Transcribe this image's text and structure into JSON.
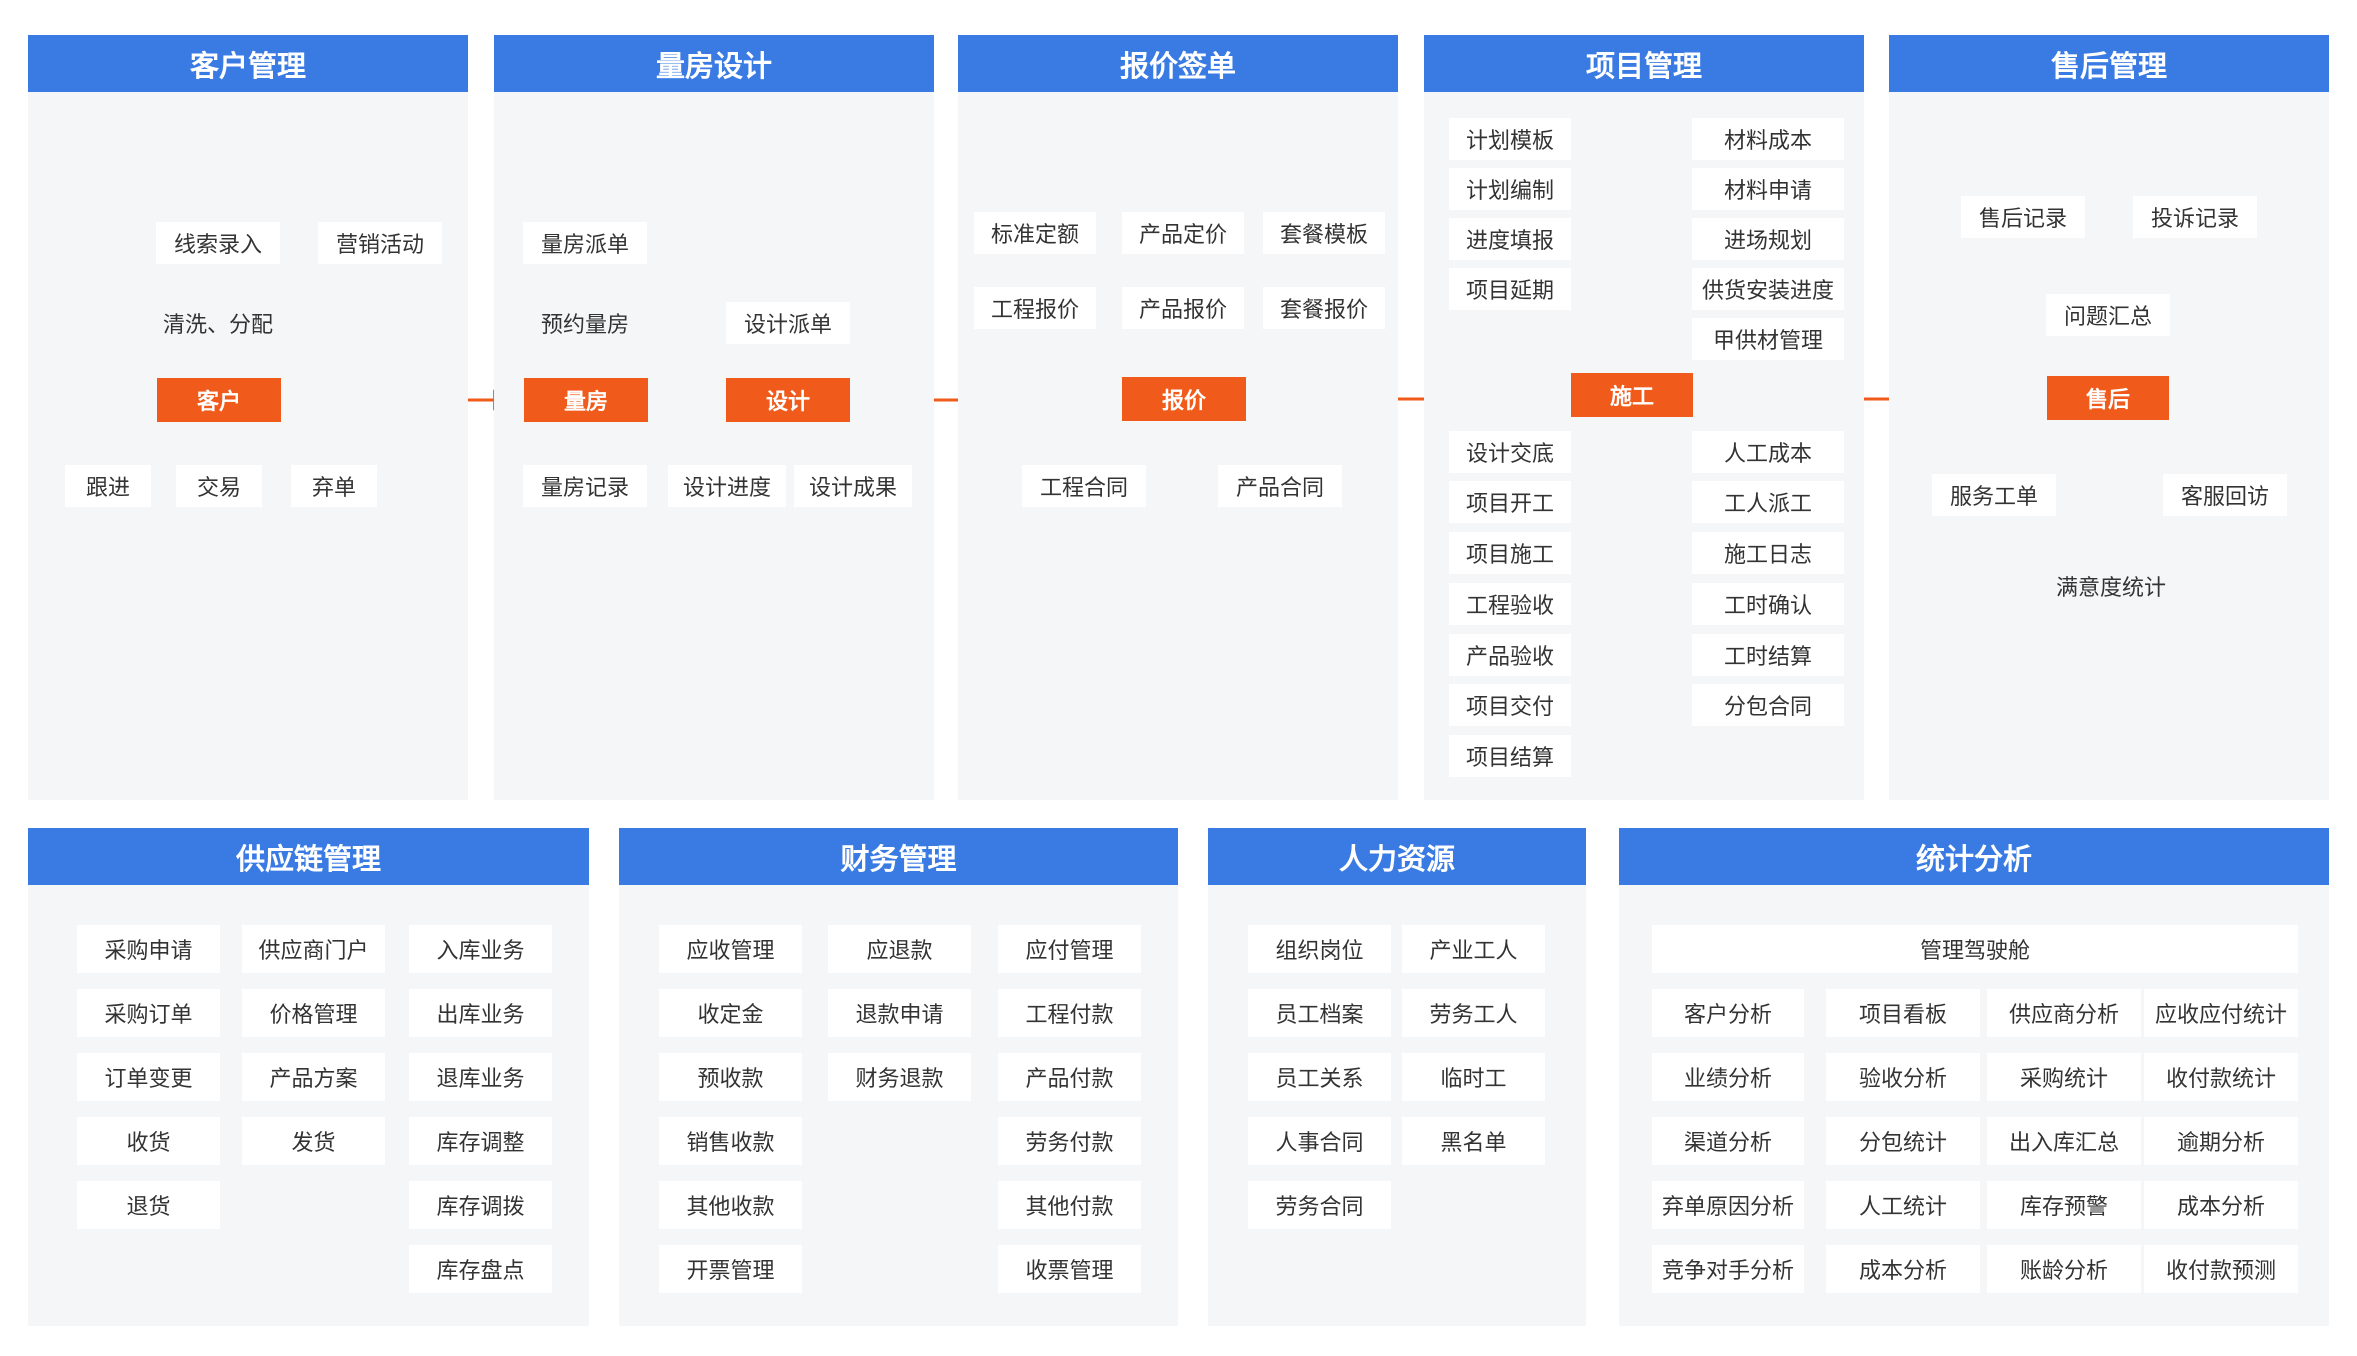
{
  "panels": {
    "customer": "客户管理",
    "measure": "量房设计",
    "quote": "报价签单",
    "project": "项目管理",
    "aftersale": "售后管理",
    "supply": "供应链管理",
    "finance": "财务管理",
    "hr": "人力资源",
    "stats": "统计分析"
  },
  "flow": {
    "customer": "客户",
    "measure": "量房",
    "design": "设计",
    "quote": "报价",
    "construct": "施工",
    "aftersale": "售后"
  },
  "customer": {
    "lead_entry": "线索录入",
    "marketing": "营销活动",
    "clean_assign": "清洗、分配",
    "follow": "跟进",
    "deal": "交易",
    "abandon": "弃单"
  },
  "measure": {
    "dispatch": "量房派单",
    "appointment": "预约量房",
    "record": "量房记录",
    "design_dispatch": "设计派单",
    "design_progress": "设计进度",
    "design_result": "设计成果"
  },
  "quote": {
    "std_quota": "标准定额",
    "product_pricing": "产品定价",
    "package_template": "套餐模板",
    "eng_quote": "工程报价",
    "product_quote": "产品报价",
    "package_quote": "套餐报价",
    "eng_contract": "工程合同",
    "product_contract": "产品合同"
  },
  "project": {
    "left_top": [
      "计划模板",
      "计划编制",
      "进度填报",
      "项目延期"
    ],
    "right_top": [
      "材料成本",
      "材料申请",
      "进场规划",
      "供货安装进度",
      "甲供材管理"
    ],
    "left_bottom": [
      "设计交底",
      "项目开工",
      "项目施工",
      "工程验收",
      "产品验收",
      "项目交付",
      "项目结算"
    ],
    "right_bottom": [
      "人工成本",
      "工人派工",
      "施工日志",
      "工时确认",
      "工时结算",
      "分包合同"
    ]
  },
  "aftersale": {
    "record": "售后记录",
    "complaint": "投诉记录",
    "summary": "问题汇总",
    "service_order": "服务工单",
    "revisit": "客服回访",
    "satisfaction": "满意度统计"
  },
  "supply": {
    "col1": [
      "采购申请",
      "采购订单",
      "订单变更",
      "收货",
      "退货"
    ],
    "col2": [
      "供应商门户",
      "价格管理",
      "产品方案",
      "发货"
    ],
    "col3": [
      "入库业务",
      "出库业务",
      "退库业务",
      "库存调整",
      "库存调拨",
      "库存盘点"
    ]
  },
  "finance": {
    "col1": [
      "应收管理",
      "收定金",
      "预收款",
      "销售收款",
      "其他收款",
      "开票管理"
    ],
    "col2": [
      "应退款",
      "退款申请",
      "财务退款"
    ],
    "col3": [
      "应付管理",
      "工程付款",
      "产品付款",
      "劳务付款",
      "其他付款",
      "收票管理"
    ]
  },
  "hr": {
    "col1": [
      "组织岗位",
      "员工档案",
      "员工关系",
      "人事合同",
      "劳务合同"
    ],
    "col2": [
      "产业工人",
      "劳务工人",
      "临时工",
      "黑名单"
    ]
  },
  "stats": {
    "cockpit": "管理驾驶舱",
    "col1": [
      "客户分析",
      "业绩分析",
      "渠道分析",
      "弃单原因分析",
      "竞争对手分析"
    ],
    "col2": [
      "项目看板",
      "验收分析",
      "分包统计",
      "人工统计",
      "成本分析"
    ],
    "col3": [
      "供应商分析",
      "采购统计",
      "出入库汇总",
      "库存预警",
      "账龄分析"
    ],
    "col4": [
      "应收应付统计",
      "收付款统计",
      "逾期分析",
      "成本分析",
      "收付款预测"
    ]
  },
  "colors": {
    "header_blue": "#3a7be3",
    "flow_orange": "#f05a1a",
    "panel_bg": "#f5f6f8"
  }
}
